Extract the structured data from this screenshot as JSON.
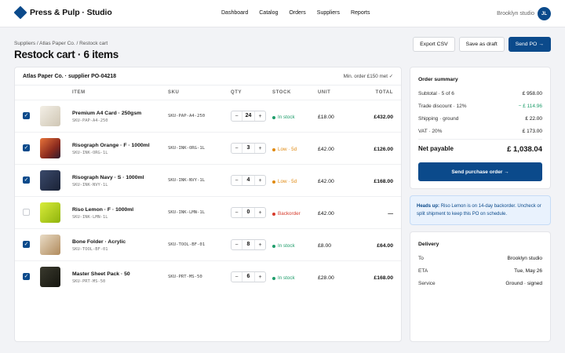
{
  "app": {
    "brand": "Press & Pulp · Studio"
  },
  "nav": [
    "Dashboard",
    "Catalog",
    "Orders",
    "Suppliers",
    "Reports"
  ],
  "user": {
    "name": "Brooklyn studio",
    "initials": "JL"
  },
  "breadcrumb": "Suppliers / Atlas Paper Co. / Restock cart",
  "title": "Restock cart · 6 items",
  "actions": {
    "export": "Export CSV",
    "draft": "Save as draft",
    "send": "Send PO →"
  },
  "cart": {
    "supplier": "Atlas Paper Co. · supplier PO-04218",
    "min_order": "Min. order £150 met ✓",
    "columns": {
      "item": "ITEM",
      "sku": "SKU",
      "qty": "QTY",
      "stock": "STOCK",
      "unit": "UNIT",
      "total": "TOTAL"
    },
    "rows": [
      {
        "checked": true,
        "name": "Premium A4 Card · 250gsm",
        "subsku": "SKU-PAP-A4-250",
        "sku": "SKU-PAP-A4-250",
        "qty": "24",
        "stock": "In stock",
        "stock_color": "#1f9d6b",
        "unit": "£18.00",
        "total": "£432.00",
        "thumb": "linear-gradient(135deg,#f3efe6,#cfc6b4)"
      },
      {
        "checked": true,
        "name": "Risograph Orange · F · 1000ml",
        "subsku": "SKU-INK-ORG-1L",
        "sku": "SKU-INK-ORG-1L",
        "qty": "3",
        "stock": "Low · 5d",
        "stock_color": "#e08a12",
        "unit": "£42.00",
        "total": "£126.00",
        "thumb": "linear-gradient(135deg,#e8743a,#8a2a1e 60%,#2d1b2e)"
      },
      {
        "checked": true,
        "name": "Risograph Navy · S · 1000ml",
        "subsku": "SKU-INK-NVY-1L",
        "sku": "SKU-INK-NVY-1L",
        "qty": "4",
        "stock": "Low · 5d",
        "stock_color": "#e08a12",
        "unit": "£42.00",
        "total": "£168.00",
        "thumb": "linear-gradient(135deg,#3b4a6b,#1a2236)"
      },
      {
        "checked": false,
        "name": "Riso Lemon · F · 1000ml",
        "subsku": "SKU-INK-LMN-1L",
        "sku": "SKU-INK-LMN-1L",
        "qty": "0",
        "stock": "Backorder",
        "stock_color": "#d63a2b",
        "unit": "£42.00",
        "total": "—",
        "thumb": "linear-gradient(135deg,#d8ec3a,#8fb30c)"
      },
      {
        "checked": true,
        "name": "Bone Folder · Acrylic",
        "subsku": "SKU-TOOL-BF-01",
        "sku": "SKU-TOOL-BF-01",
        "qty": "8",
        "stock": "In stock",
        "stock_color": "#1f9d6b",
        "unit": "£8.00",
        "total": "£64.00",
        "thumb": "linear-gradient(135deg,#e9dcc6,#b08a5c)"
      },
      {
        "checked": true,
        "name": "Master Sheet Pack · 50",
        "subsku": "SKU-PRT-MS-50",
        "sku": "SKU-PRT-MS-50",
        "qty": "6",
        "stock": "In stock",
        "stock_color": "#1f9d6b",
        "unit": "£28.00",
        "total": "£168.00",
        "thumb": "linear-gradient(135deg,#3a3a2e,#15150f)"
      }
    ]
  },
  "summary": {
    "title": "Order summary",
    "rows": [
      {
        "label": "Subtotal · 5 of 6",
        "value": "£ 958.00"
      },
      {
        "label": "Trade discount · 12%",
        "value": "− £ 114.96"
      },
      {
        "label": "Shipping · ground",
        "value": "£ 22.00"
      },
      {
        "label": "VAT · 20%",
        "value": "£ 173.00"
      }
    ],
    "net_label": "Net payable",
    "net_value": "£ 1,038.04",
    "send_button": "Send purchase order →"
  },
  "alert": {
    "heading": "Heads up:",
    "text": "Riso Lemon is on 14-day backorder. Uncheck or split shipment to keep this PO on schedule."
  },
  "delivery": {
    "title": "Delivery",
    "rows": [
      {
        "label": "To",
        "value": "Brooklyn studio"
      },
      {
        "label": "ETA",
        "value": "Tue, May 26"
      },
      {
        "label": "Service",
        "value": "Ground · signed"
      }
    ]
  },
  "colors": {
    "accent": "#0b4a8b",
    "in_stock": "#1f9d6b",
    "low": "#e08a12",
    "backorder": "#d63a2b",
    "discount": "#1f9d6b"
  }
}
